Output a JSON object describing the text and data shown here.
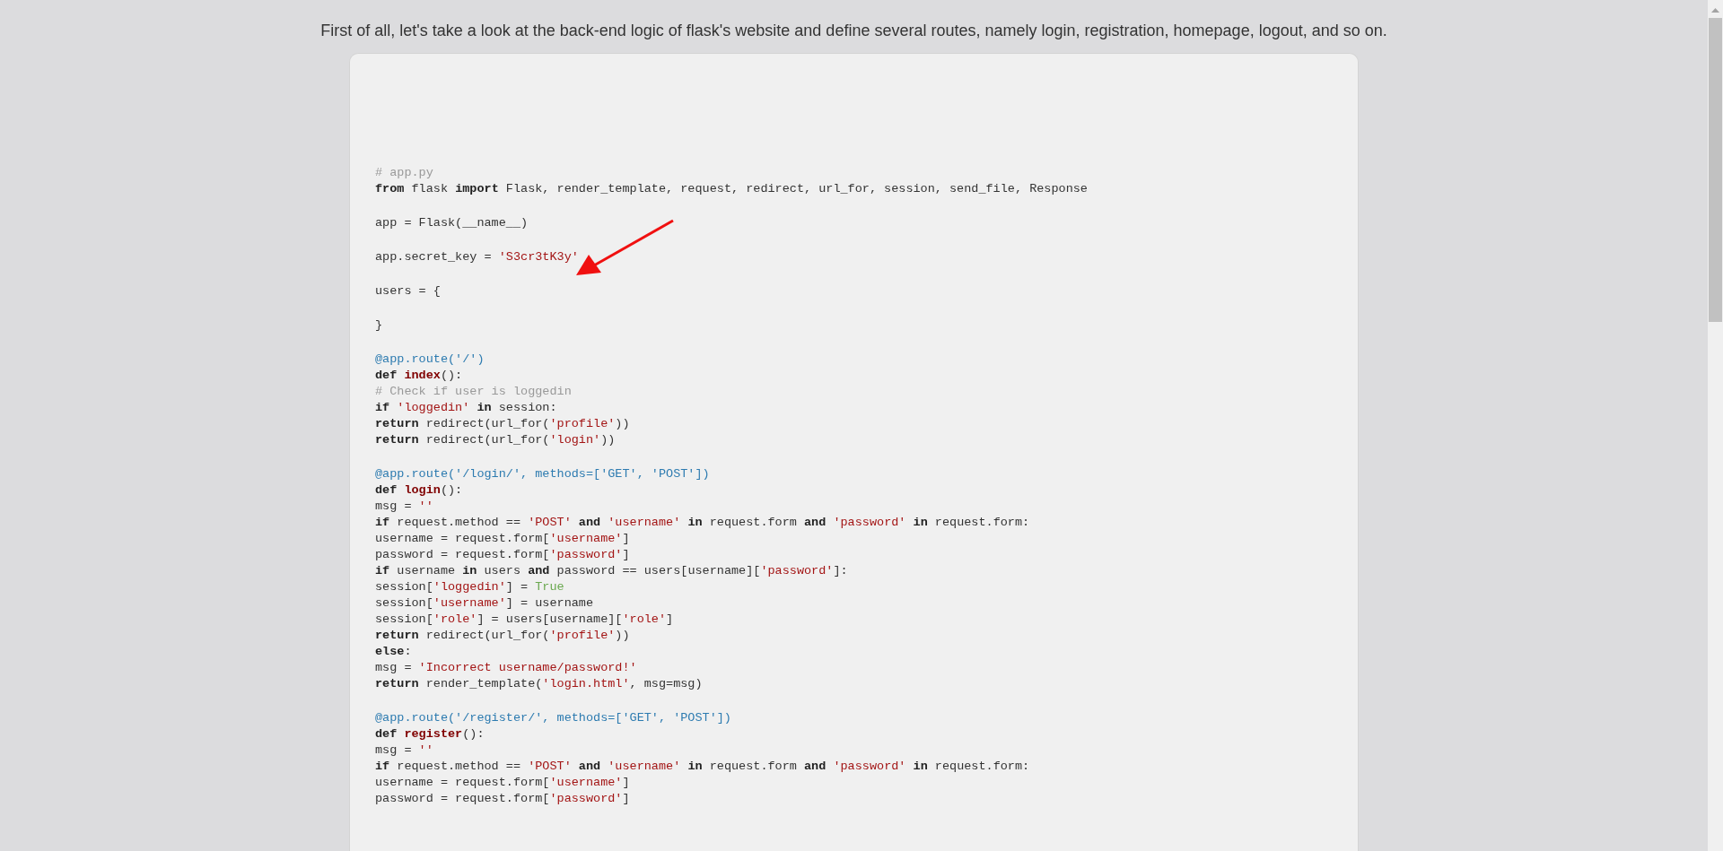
{
  "intro": "First of all, let's take a look at the back-end logic of flask's website and define several routes, namely login, registration, homepage, logout, and so on.",
  "code_blocks": [
    {
      "lines": [
        [
          {
            "kind": "comment",
            "text": "# app.py"
          }
        ],
        [
          {
            "kind": "keyword",
            "text": "from"
          },
          {
            "kind": "plain",
            "text": " flask "
          },
          {
            "kind": "keyword",
            "text": "import"
          },
          {
            "kind": "plain",
            "text": " Flask, render_template, request, redirect, url_for, session, send_file, Response"
          }
        ]
      ]
    },
    {
      "lines": [
        [
          {
            "kind": "plain",
            "text": "app = Flask(__name__)"
          }
        ]
      ]
    },
    {
      "lines": [
        [
          {
            "kind": "plain",
            "text": "app.secret_key = "
          },
          {
            "kind": "string",
            "text": "'S3cr3tK3y'"
          }
        ]
      ]
    },
    {
      "lines": [
        [
          {
            "kind": "plain",
            "text": "users = {"
          }
        ]
      ]
    },
    {
      "lines": [
        [
          {
            "kind": "plain",
            "text": "}"
          }
        ]
      ]
    },
    {
      "lines": [
        [
          {
            "kind": "decorator",
            "text": "@app.route('/')"
          }
        ],
        [
          {
            "kind": "keyword",
            "text": "def "
          },
          {
            "kind": "function",
            "text": "index"
          },
          {
            "kind": "plain",
            "text": "():"
          }
        ],
        [
          {
            "kind": "comment",
            "text": "# Check if user is loggedin"
          }
        ],
        [
          {
            "kind": "keyword",
            "text": "if "
          },
          {
            "kind": "string",
            "text": "'loggedin'"
          },
          {
            "kind": "keyword",
            "text": " in"
          },
          {
            "kind": "plain",
            "text": " session:"
          }
        ],
        [
          {
            "kind": "keyword",
            "text": "return"
          },
          {
            "kind": "plain",
            "text": " redirect(url_for("
          },
          {
            "kind": "string",
            "text": "'profile'"
          },
          {
            "kind": "plain",
            "text": "))"
          }
        ],
        [
          {
            "kind": "keyword",
            "text": "return"
          },
          {
            "kind": "plain",
            "text": " redirect(url_for("
          },
          {
            "kind": "string",
            "text": "'login'"
          },
          {
            "kind": "plain",
            "text": "))"
          }
        ]
      ]
    },
    {
      "lines": [
        [
          {
            "kind": "decorator",
            "text": "@app.route('/login/', methods=['GET', 'POST'])"
          }
        ],
        [
          {
            "kind": "keyword",
            "text": "def "
          },
          {
            "kind": "function",
            "text": "login"
          },
          {
            "kind": "plain",
            "text": "():"
          }
        ],
        [
          {
            "kind": "plain",
            "text": "msg = "
          },
          {
            "kind": "string",
            "text": "''"
          }
        ],
        [
          {
            "kind": "keyword",
            "text": "if"
          },
          {
            "kind": "plain",
            "text": " request.method == "
          },
          {
            "kind": "string",
            "text": "'POST'"
          },
          {
            "kind": "keyword",
            "text": " and "
          },
          {
            "kind": "string",
            "text": "'username'"
          },
          {
            "kind": "keyword",
            "text": " in"
          },
          {
            "kind": "plain",
            "text": " request.form "
          },
          {
            "kind": "keyword",
            "text": "and "
          },
          {
            "kind": "string",
            "text": "'password'"
          },
          {
            "kind": "keyword",
            "text": " in"
          },
          {
            "kind": "plain",
            "text": " request.form:"
          }
        ],
        [
          {
            "kind": "plain",
            "text": "username = request.form["
          },
          {
            "kind": "string",
            "text": "'username'"
          },
          {
            "kind": "plain",
            "text": "]"
          }
        ],
        [
          {
            "kind": "plain",
            "text": "password = request.form["
          },
          {
            "kind": "string",
            "text": "'password'"
          },
          {
            "kind": "plain",
            "text": "]"
          }
        ],
        [
          {
            "kind": "keyword",
            "text": "if"
          },
          {
            "kind": "plain",
            "text": " username "
          },
          {
            "kind": "keyword",
            "text": "in"
          },
          {
            "kind": "plain",
            "text": " users "
          },
          {
            "kind": "keyword",
            "text": "and"
          },
          {
            "kind": "plain",
            "text": " password == users[username]["
          },
          {
            "kind": "string",
            "text": "'password'"
          },
          {
            "kind": "plain",
            "text": "]:"
          }
        ],
        [
          {
            "kind": "plain",
            "text": "session["
          },
          {
            "kind": "string",
            "text": "'loggedin'"
          },
          {
            "kind": "plain",
            "text": "] = "
          },
          {
            "kind": "builtin",
            "text": "True"
          }
        ],
        [
          {
            "kind": "plain",
            "text": "session["
          },
          {
            "kind": "string",
            "text": "'username'"
          },
          {
            "kind": "plain",
            "text": "] = username"
          }
        ],
        [
          {
            "kind": "plain",
            "text": "session["
          },
          {
            "kind": "string",
            "text": "'role'"
          },
          {
            "kind": "plain",
            "text": "] = users[username]["
          },
          {
            "kind": "string",
            "text": "'role'"
          },
          {
            "kind": "plain",
            "text": "]"
          }
        ],
        [
          {
            "kind": "keyword",
            "text": "return"
          },
          {
            "kind": "plain",
            "text": " redirect(url_for("
          },
          {
            "kind": "string",
            "text": "'profile'"
          },
          {
            "kind": "plain",
            "text": "))"
          }
        ],
        [
          {
            "kind": "keyword",
            "text": "else"
          },
          {
            "kind": "plain",
            "text": ":"
          }
        ],
        [
          {
            "kind": "plain",
            "text": "msg = "
          },
          {
            "kind": "string",
            "text": "'Incorrect username/password!'"
          }
        ],
        [
          {
            "kind": "keyword",
            "text": "return"
          },
          {
            "kind": "plain",
            "text": " render_template("
          },
          {
            "kind": "string",
            "text": "'login.html'"
          },
          {
            "kind": "plain",
            "text": ", msg=msg)"
          }
        ]
      ]
    },
    {
      "lines": [
        [
          {
            "kind": "decorator",
            "text": "@app.route('/register/', methods=['GET', 'POST'])"
          }
        ],
        [
          {
            "kind": "keyword",
            "text": "def "
          },
          {
            "kind": "function",
            "text": "register"
          },
          {
            "kind": "plain",
            "text": "():"
          }
        ],
        [
          {
            "kind": "plain",
            "text": "msg = "
          },
          {
            "kind": "string",
            "text": "''"
          }
        ],
        [
          {
            "kind": "keyword",
            "text": "if"
          },
          {
            "kind": "plain",
            "text": " request.method == "
          },
          {
            "kind": "string",
            "text": "'POST'"
          },
          {
            "kind": "keyword",
            "text": " and "
          },
          {
            "kind": "string",
            "text": "'username'"
          },
          {
            "kind": "keyword",
            "text": " in"
          },
          {
            "kind": "plain",
            "text": " request.form "
          },
          {
            "kind": "keyword",
            "text": "and "
          },
          {
            "kind": "string",
            "text": "'password'"
          },
          {
            "kind": "keyword",
            "text": " in"
          },
          {
            "kind": "plain",
            "text": " request.form:"
          }
        ],
        [
          {
            "kind": "plain",
            "text": "username = request.form["
          },
          {
            "kind": "string",
            "text": "'username'"
          },
          {
            "kind": "plain",
            "text": "]"
          }
        ],
        [
          {
            "kind": "plain",
            "text": "password = request.form["
          },
          {
            "kind": "string",
            "text": "'password'"
          },
          {
            "kind": "plain",
            "text": "]"
          }
        ]
      ]
    }
  ]
}
